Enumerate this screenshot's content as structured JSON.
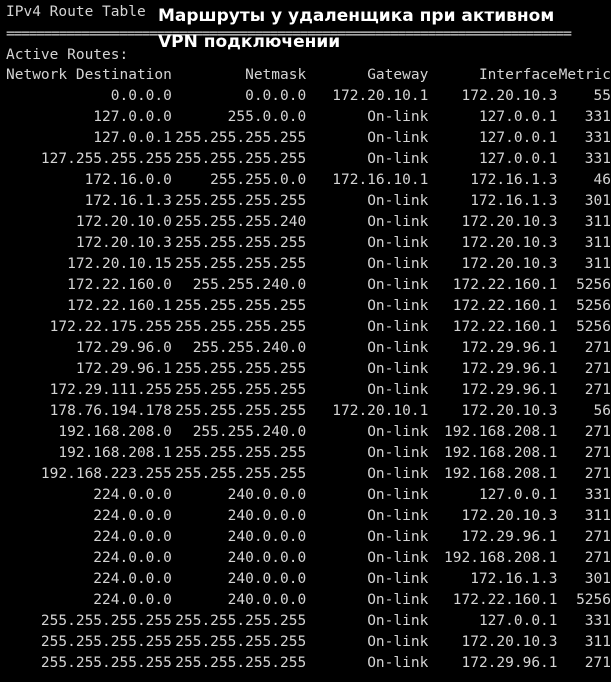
{
  "terminal": {
    "section_title": "IPv4 Route Table",
    "rule": "===========================================================================",
    "active_label": "Active Routes:",
    "overlay_title": "Маршруты у удаленщика при активном VPN подключении",
    "colors": {
      "background": "#000000",
      "text": "#d4d4d4",
      "overlay_text": "#ffffff"
    }
  },
  "table": {
    "headers": {
      "dest": "Network Destination",
      "mask": "Netmask",
      "gw": "Gateway",
      "iface": "Interface",
      "metric": "Metric"
    },
    "rows": [
      {
        "dest": "0.0.0.0",
        "mask": "0.0.0.0",
        "gw": "172.20.10.1",
        "iface": "172.20.10.3",
        "metric": "55"
      },
      {
        "dest": "127.0.0.0",
        "mask": "255.0.0.0",
        "gw": "On-link",
        "iface": "127.0.0.1",
        "metric": "331"
      },
      {
        "dest": "127.0.0.1",
        "mask": "255.255.255.255",
        "gw": "On-link",
        "iface": "127.0.0.1",
        "metric": "331"
      },
      {
        "dest": "127.255.255.255",
        "mask": "255.255.255.255",
        "gw": "On-link",
        "iface": "127.0.0.1",
        "metric": "331"
      },
      {
        "dest": "172.16.0.0",
        "mask": "255.255.0.0",
        "gw": "172.16.10.1",
        "iface": "172.16.1.3",
        "metric": "46"
      },
      {
        "dest": "172.16.1.3",
        "mask": "255.255.255.255",
        "gw": "On-link",
        "iface": "172.16.1.3",
        "metric": "301"
      },
      {
        "dest": "172.20.10.0",
        "mask": "255.255.255.240",
        "gw": "On-link",
        "iface": "172.20.10.3",
        "metric": "311"
      },
      {
        "dest": "172.20.10.3",
        "mask": "255.255.255.255",
        "gw": "On-link",
        "iface": "172.20.10.3",
        "metric": "311"
      },
      {
        "dest": "172.20.10.15",
        "mask": "255.255.255.255",
        "gw": "On-link",
        "iface": "172.20.10.3",
        "metric": "311"
      },
      {
        "dest": "172.22.160.0",
        "mask": "255.255.240.0",
        "gw": "On-link",
        "iface": "172.22.160.1",
        "metric": "5256"
      },
      {
        "dest": "172.22.160.1",
        "mask": "255.255.255.255",
        "gw": "On-link",
        "iface": "172.22.160.1",
        "metric": "5256"
      },
      {
        "dest": "172.22.175.255",
        "mask": "255.255.255.255",
        "gw": "On-link",
        "iface": "172.22.160.1",
        "metric": "5256"
      },
      {
        "dest": "172.29.96.0",
        "mask": "255.255.240.0",
        "gw": "On-link",
        "iface": "172.29.96.1",
        "metric": "271"
      },
      {
        "dest": "172.29.96.1",
        "mask": "255.255.255.255",
        "gw": "On-link",
        "iface": "172.29.96.1",
        "metric": "271"
      },
      {
        "dest": "172.29.111.255",
        "mask": "255.255.255.255",
        "gw": "On-link",
        "iface": "172.29.96.1",
        "metric": "271"
      },
      {
        "dest": "178.76.194.178",
        "mask": "255.255.255.255",
        "gw": "172.20.10.1",
        "iface": "172.20.10.3",
        "metric": "56"
      },
      {
        "dest": "192.168.208.0",
        "mask": "255.255.240.0",
        "gw": "On-link",
        "iface": "192.168.208.1",
        "metric": "271"
      },
      {
        "dest": "192.168.208.1",
        "mask": "255.255.255.255",
        "gw": "On-link",
        "iface": "192.168.208.1",
        "metric": "271"
      },
      {
        "dest": "192.168.223.255",
        "mask": "255.255.255.255",
        "gw": "On-link",
        "iface": "192.168.208.1",
        "metric": "271"
      },
      {
        "dest": "224.0.0.0",
        "mask": "240.0.0.0",
        "gw": "On-link",
        "iface": "127.0.0.1",
        "metric": "331"
      },
      {
        "dest": "224.0.0.0",
        "mask": "240.0.0.0",
        "gw": "On-link",
        "iface": "172.20.10.3",
        "metric": "311"
      },
      {
        "dest": "224.0.0.0",
        "mask": "240.0.0.0",
        "gw": "On-link",
        "iface": "172.29.96.1",
        "metric": "271"
      },
      {
        "dest": "224.0.0.0",
        "mask": "240.0.0.0",
        "gw": "On-link",
        "iface": "192.168.208.1",
        "metric": "271"
      },
      {
        "dest": "224.0.0.0",
        "mask": "240.0.0.0",
        "gw": "On-link",
        "iface": "172.16.1.3",
        "metric": "301"
      },
      {
        "dest": "224.0.0.0",
        "mask": "240.0.0.0",
        "gw": "On-link",
        "iface": "172.22.160.1",
        "metric": "5256"
      },
      {
        "dest": "255.255.255.255",
        "mask": "255.255.255.255",
        "gw": "On-link",
        "iface": "127.0.0.1",
        "metric": "331"
      },
      {
        "dest": "255.255.255.255",
        "mask": "255.255.255.255",
        "gw": "On-link",
        "iface": "172.20.10.3",
        "metric": "311"
      },
      {
        "dest": "255.255.255.255",
        "mask": "255.255.255.255",
        "gw": "On-link",
        "iface": "172.29.96.1",
        "metric": "271"
      }
    ]
  }
}
